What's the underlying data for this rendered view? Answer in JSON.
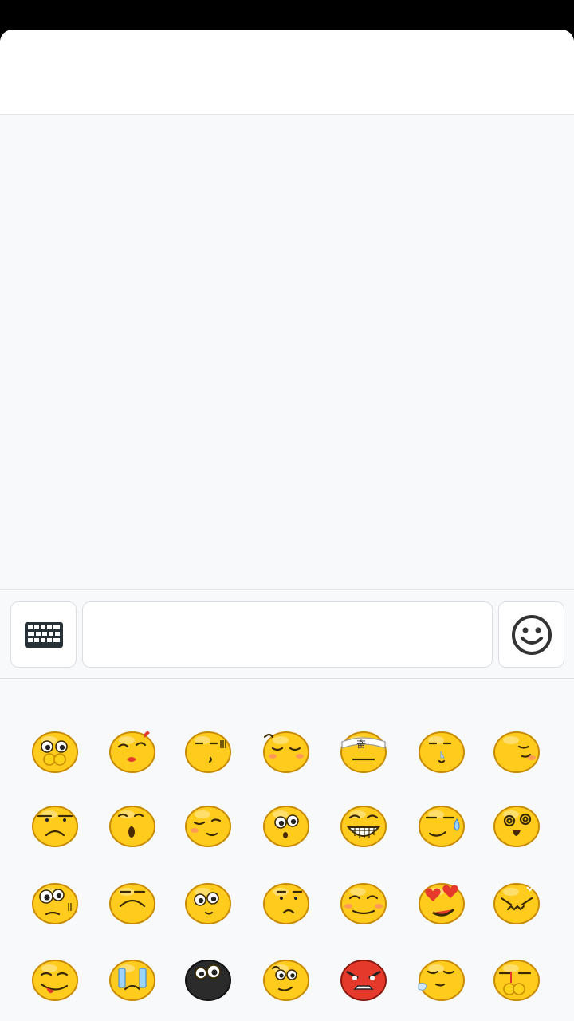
{
  "header": {
    "title": ""
  },
  "composer": {
    "keyboard_icon": "keyboard-icon",
    "message_value": "",
    "message_placeholder": "",
    "emoji_icon": "smiley-icon"
  },
  "emoji_panel": {
    "rows": [
      [
        "shy",
        "kiss",
        "puzzled",
        "sleepy",
        "struggle",
        "snot",
        "smirk"
      ],
      [
        "frown",
        "surprised",
        "grin-shy",
        "stare",
        "laugh",
        "sweat",
        "dizzy"
      ],
      [
        "eye-roll",
        "sad",
        "pitiful",
        "speechless",
        "blush",
        "heart-eyes",
        "angry-glare"
      ],
      [
        "tongue",
        "cry",
        "black-face",
        "awkward",
        "rage",
        "drool",
        "tearful"
      ]
    ]
  },
  "colors": {
    "emoji_face": "#ffcc1e",
    "emoji_outline": "#c88a00",
    "accent_red": "#e53a2b",
    "black_face": "#2b2b2b"
  }
}
